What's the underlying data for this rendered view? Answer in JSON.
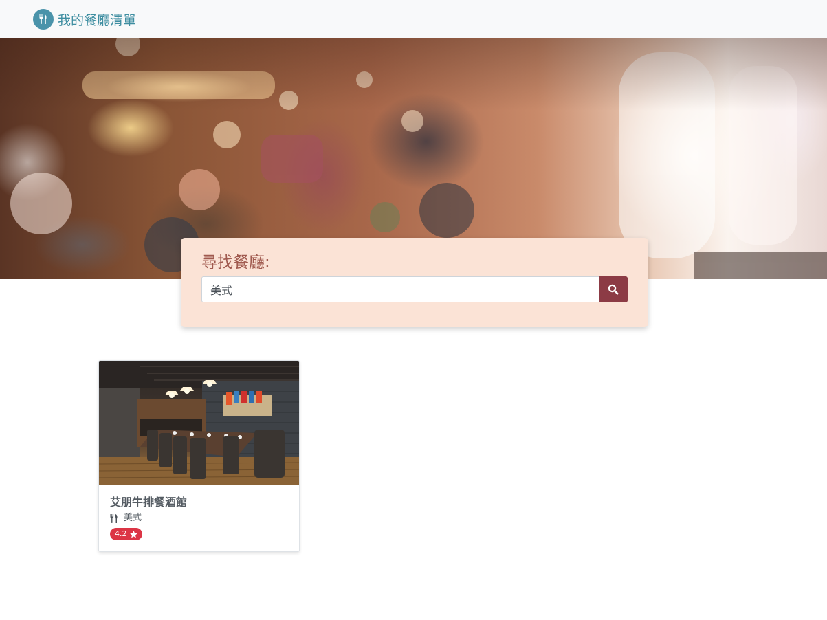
{
  "navbar": {
    "brand_title": "我的餐廳清單",
    "brand_icon": "utensils-icon",
    "brand_color": "#3f8ea1"
  },
  "search": {
    "title": "尋找餐廳:",
    "value": "美式",
    "button_icon": "search-icon",
    "button_color": "#8c3b45",
    "card_bg": "#fbe3d6"
  },
  "restaurants": [
    {
      "name": "艾朋牛排餐酒館",
      "category": "美式",
      "category_icon": "utensils-icon",
      "rating": "4.2",
      "rating_icon": "star-icon",
      "rating_color": "#dc3545"
    }
  ]
}
